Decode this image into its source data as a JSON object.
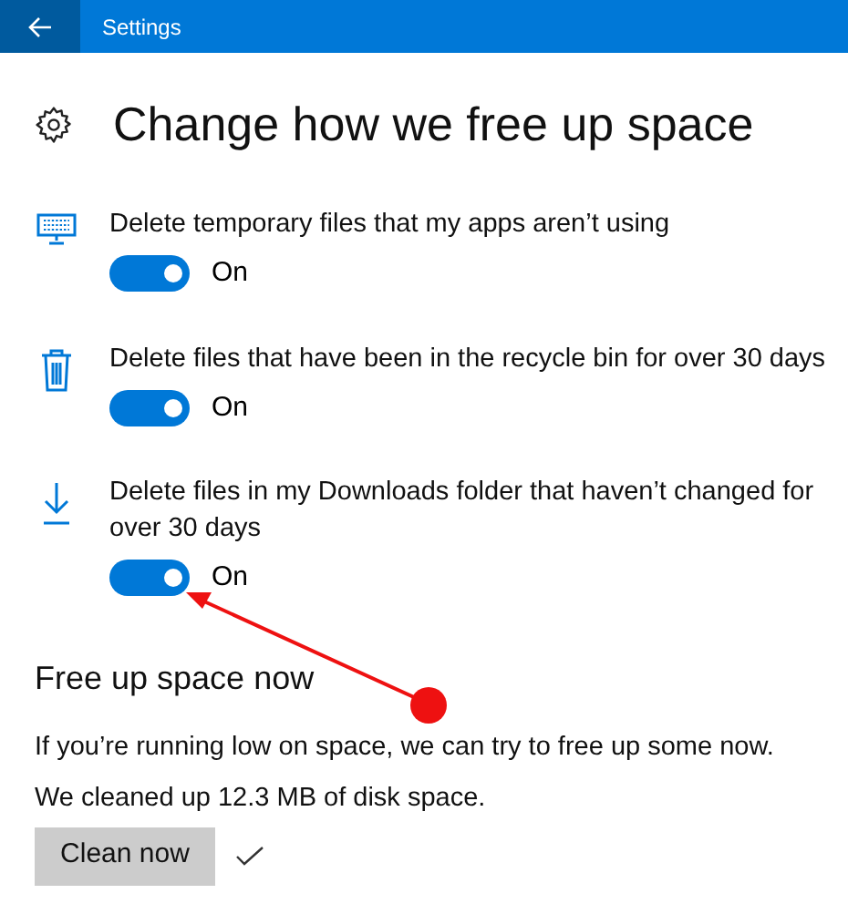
{
  "window": {
    "title": "Settings"
  },
  "heading": "Change how we free up space",
  "options": [
    {
      "kind": "monitor",
      "label": "Delete temporary files that my apps aren’t using",
      "on": true,
      "state_label": "On"
    },
    {
      "kind": "trash",
      "label": "Delete files that have been in the recycle bin for over 30 days",
      "on": true,
      "state_label": "On"
    },
    {
      "kind": "download",
      "label": "Delete files in my Downloads folder that haven’t changed for over 30 days",
      "on": true,
      "state_label": "On"
    }
  ],
  "free_now": {
    "title": "Free up space now",
    "description": "If you’re running low on space, we can try to free up some now.",
    "result": "We cleaned up 12.3 MB of disk space.",
    "button": "Clean now",
    "done": true
  }
}
